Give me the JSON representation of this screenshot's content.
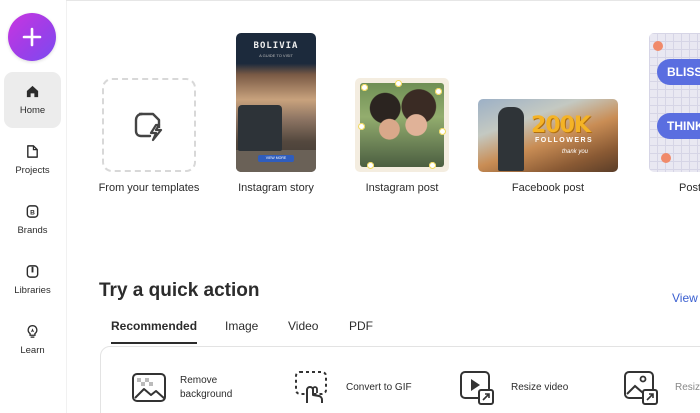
{
  "sidebar": {
    "create_icon": "plus-icon",
    "items": [
      {
        "label": "Home",
        "icon": "home-icon",
        "active": true
      },
      {
        "label": "Projects",
        "icon": "file-icon"
      },
      {
        "label": "Brands",
        "icon": "brand-icon"
      },
      {
        "label": "Libraries",
        "icon": "library-icon"
      },
      {
        "label": "Learn",
        "icon": "lightbulb-icon"
      }
    ]
  },
  "templates": {
    "items": [
      {
        "label": "From your templates",
        "icon": "template-lightning-icon"
      },
      {
        "label": "Instagram story",
        "thumb_title": "BOLIVIA",
        "thumb_subtitle": "A GUIDE TO VISIT",
        "thumb_button": "VIEW MORE"
      },
      {
        "label": "Instagram post"
      },
      {
        "label": "Facebook post",
        "thumb_big": "200K",
        "thumb_line": "FOLLOWERS",
        "thumb_script": "thank you"
      },
      {
        "label": "Post",
        "thumb_words": [
          "BLISS",
          "THINK"
        ]
      }
    ]
  },
  "quick_actions": {
    "title": "Try a quick action",
    "view_all": "View",
    "tabs": [
      "Recommended",
      "Image",
      "Video",
      "PDF"
    ],
    "active_tab": "Recommended",
    "actions": [
      {
        "label_line1": "Remove",
        "label_line2": "background",
        "icon": "remove-background-icon"
      },
      {
        "label_line1": "Convert to GIF",
        "icon": "convert-gif-icon"
      },
      {
        "label_line1": "Resize video",
        "icon": "resize-video-icon"
      },
      {
        "label_line1": "Resiz",
        "icon": "resize-image-icon"
      }
    ]
  },
  "colors": {
    "create_gradient_start": "#c935e0",
    "create_gradient_end": "#7b4bf0",
    "link": "#3a5fd0",
    "active_nav_bg": "#ececec"
  }
}
